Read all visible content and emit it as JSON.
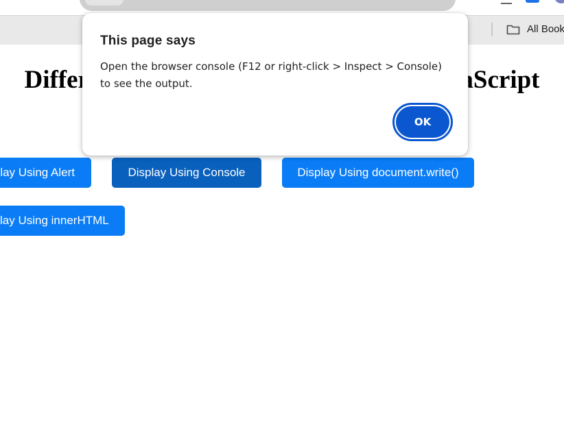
{
  "browser": {
    "bookmarks_bar": {
      "folder_label": "All Book",
      "folder_icon": "folder-icon"
    },
    "toolbar_icons": [
      "downloads-icon",
      "extensions-icon",
      "profile-avatar"
    ]
  },
  "page": {
    "title": "Different Ways to Display Output in JavaScript",
    "buttons": [
      {
        "label": "Display Using Alert",
        "visible_label": "lay Using Alert"
      },
      {
        "label": "Display Using Console"
      },
      {
        "label": "Display Using document.write()"
      },
      {
        "label": "Display Using innerHTML",
        "visible_label": "lay Using innerHTML"
      }
    ]
  },
  "dialog": {
    "title": "This page says",
    "message": "Open the browser console (F12 or right-click > Inspect > Console) to see the output.",
    "ok_label": "OK"
  },
  "colors": {
    "button_primary": "#0a7cf5",
    "button_active": "#0960bd",
    "dialog_ok": "#0b57d0",
    "bookmarks_bar_bg": "#e9e9e9"
  }
}
